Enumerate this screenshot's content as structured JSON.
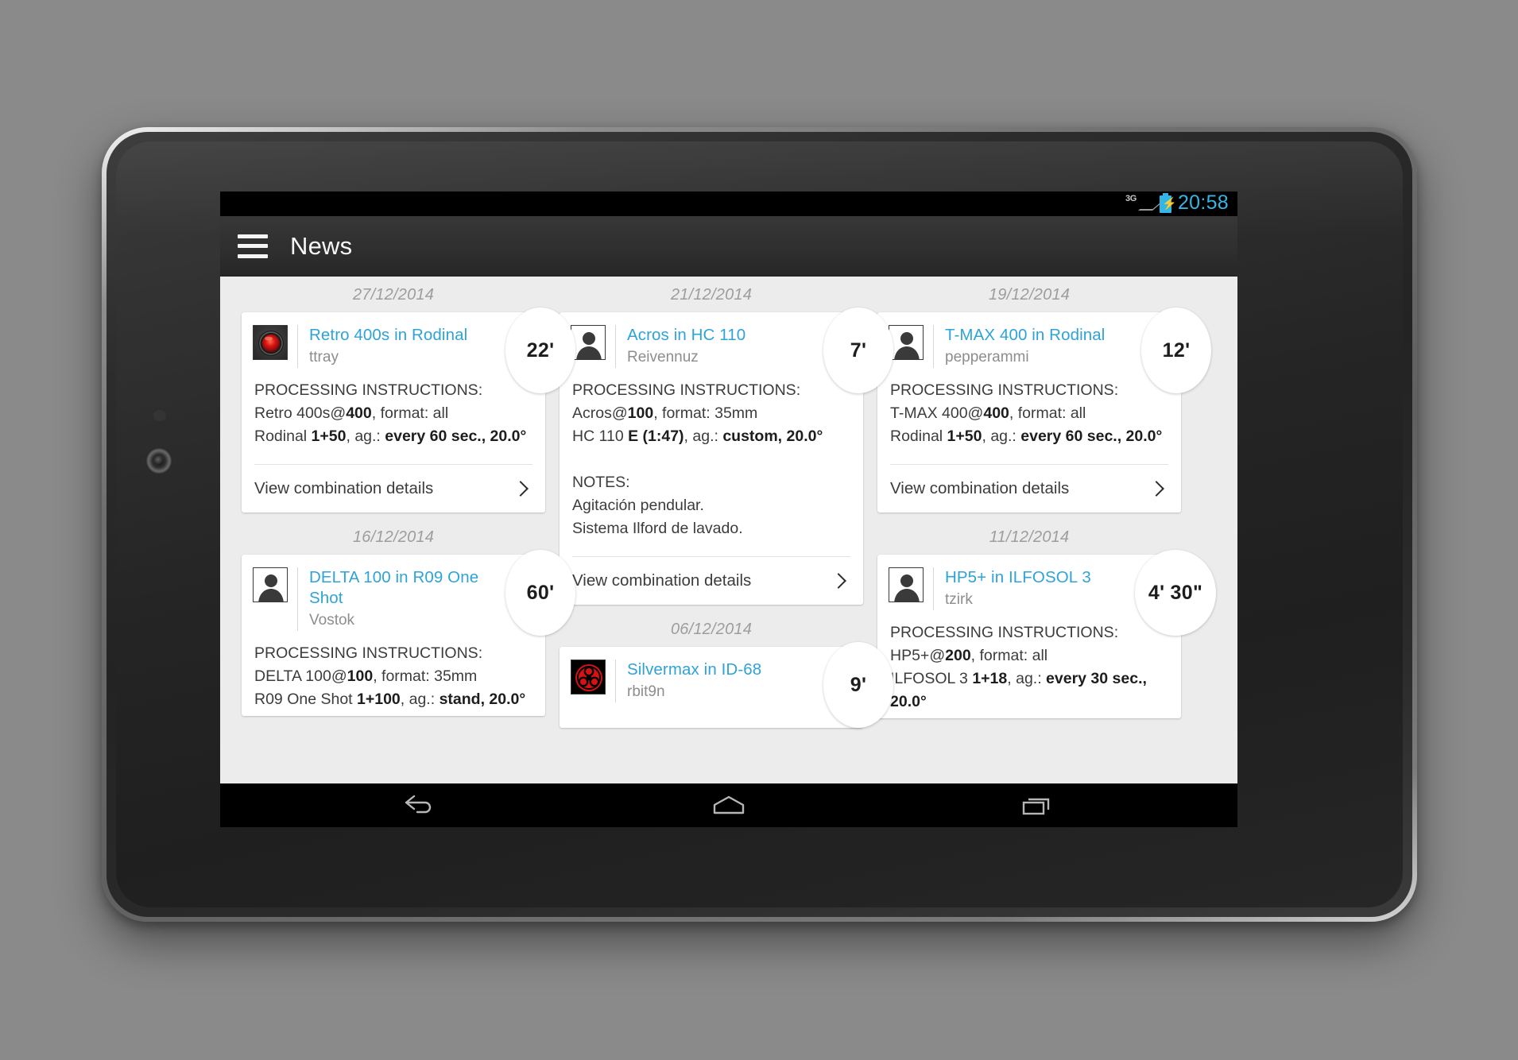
{
  "device": {
    "type": "android-tablet"
  },
  "status_bar": {
    "network": "3G",
    "battery_state": "charging",
    "clock": "20:58",
    "accent_color": "#33b5e5"
  },
  "action_bar": {
    "drawer_icon": "hamburger-menu-icon",
    "title": "News"
  },
  "nav_bar": {
    "back": "back-icon",
    "home": "home-icon",
    "recents": "recents-icon"
  },
  "theme": {
    "background": "#ececec",
    "card": "#ffffff",
    "link": "#2ea3d8",
    "muted": "#8d8d8d",
    "date": "#9d9d9d"
  },
  "labels": {
    "processing_heading": "PROCESSING INSTRUCTIONS:",
    "notes_heading": "NOTES:",
    "view_details": "View combination details"
  },
  "columns": [
    {
      "cards": [
        {
          "date": "27/12/2014",
          "avatar": "hal9000-avatar",
          "title": "Retro 400s in Rodinal",
          "user": "ttray",
          "time": "22'",
          "film_line": "Retro 400s@400, format: all",
          "film_pre": "Retro 400s@",
          "film_bold": "400",
          "film_post": ", format: all",
          "dev_pre": "Rodinal ",
          "dev_bold": "1+50",
          "dev_mid": ", ag.: ",
          "dev_bold2": "every 60 sec., 20.0°",
          "notes": [],
          "has_footer": true
        },
        {
          "date": "16/12/2014",
          "avatar": "person-avatar",
          "title": "DELTA 100 in R09 One Shot",
          "user": "Vostok",
          "time": "60'",
          "film_pre": "DELTA 100@",
          "film_bold": "100",
          "film_post": ", format: 35mm",
          "dev_pre": "R09 One Shot ",
          "dev_bold": "1+100",
          "dev_mid": ", ag.: ",
          "dev_bold2": "stand, 20.0°",
          "notes": [],
          "has_footer": false
        }
      ]
    },
    {
      "cards": [
        {
          "date": "21/12/2014",
          "avatar": "person-avatar",
          "title": "Acros in HC 110",
          "user": "Reivennuz",
          "time": "7'",
          "film_pre": "Acros@",
          "film_bold": "100",
          "film_post": ", format: 35mm",
          "dev_pre": "HC 110 ",
          "dev_bold": "E (1:47)",
          "dev_mid": ", ag.: ",
          "dev_bold2": "custom, 20.0°",
          "notes": [
            "Agitación pendular.",
            "Sistema Ilford de lavado."
          ],
          "has_footer": true
        },
        {
          "date": "06/12/2014",
          "avatar": "biohazard-avatar",
          "title": "Silvermax in ID-68",
          "user": "rbit9n",
          "time": "9'",
          "film_pre": "",
          "film_bold": "",
          "film_post": "",
          "dev_pre": "",
          "dev_bold": "",
          "dev_mid": "",
          "dev_bold2": "",
          "notes": [],
          "has_footer": false,
          "truncated": true
        }
      ]
    },
    {
      "cards": [
        {
          "date": "19/12/2014",
          "avatar": "person-avatar",
          "title": "T-MAX 400 in Rodinal",
          "user": "pepperammi",
          "time": "12'",
          "film_pre": "T-MAX 400@",
          "film_bold": "400",
          "film_post": ", format: all",
          "dev_pre": "Rodinal ",
          "dev_bold": "1+50",
          "dev_mid": ", ag.: ",
          "dev_bold2": "every 60 sec., 20.0°",
          "notes": [],
          "has_footer": true
        },
        {
          "date": "11/12/2014",
          "avatar": "person-avatar",
          "title": "HP5+ in ILFOSOL 3",
          "user": "tzirk",
          "time": "4' 30\"",
          "time_wide": true,
          "film_pre": "HP5+@",
          "film_bold": "200",
          "film_post": ", format: all",
          "dev_pre": "ILFOSOL 3 ",
          "dev_bold": "1+18",
          "dev_mid": ", ag.: ",
          "dev_bold2": "every 30 sec., 20.0°",
          "notes": [],
          "has_footer": false
        }
      ]
    }
  ]
}
